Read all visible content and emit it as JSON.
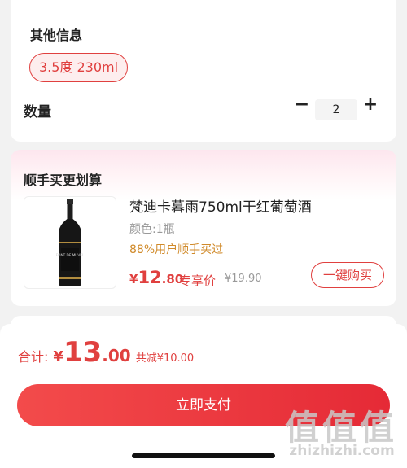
{
  "spec": {
    "other_info_label": "其他信息",
    "option_chip": "3.5度 230ml",
    "quantity_label": "数量",
    "quantity_minus": "−",
    "quantity_value": "2",
    "quantity_plus": "+"
  },
  "addon": {
    "title": "顺手买更划算",
    "product": {
      "image_label": "FONT DE MUVEL",
      "name": "梵迪卡暮雨750ml干红葡萄酒",
      "variant": "颜色:1瓶",
      "social_proof": "88%用户顺手买过",
      "price_yen": "¥",
      "price_int": "12",
      "price_dec": ".80",
      "price_tag": "专享价",
      "original_price": "¥19.90",
      "buy_button": "一键购买"
    }
  },
  "footer": {
    "total_label": "合计:",
    "total_yen": "¥",
    "total_int": "13",
    "total_dec": ".00",
    "discount": "共减¥10.00",
    "pay_button": "立即支付"
  },
  "watermark": {
    "glyph": "值",
    "text": "zhizhizhi.com"
  },
  "colors": {
    "accent": "#e0403f",
    "social_proof": "#d08a2a",
    "pay_gradient_start": "#f34b4b",
    "pay_gradient_end": "#e52a36"
  }
}
